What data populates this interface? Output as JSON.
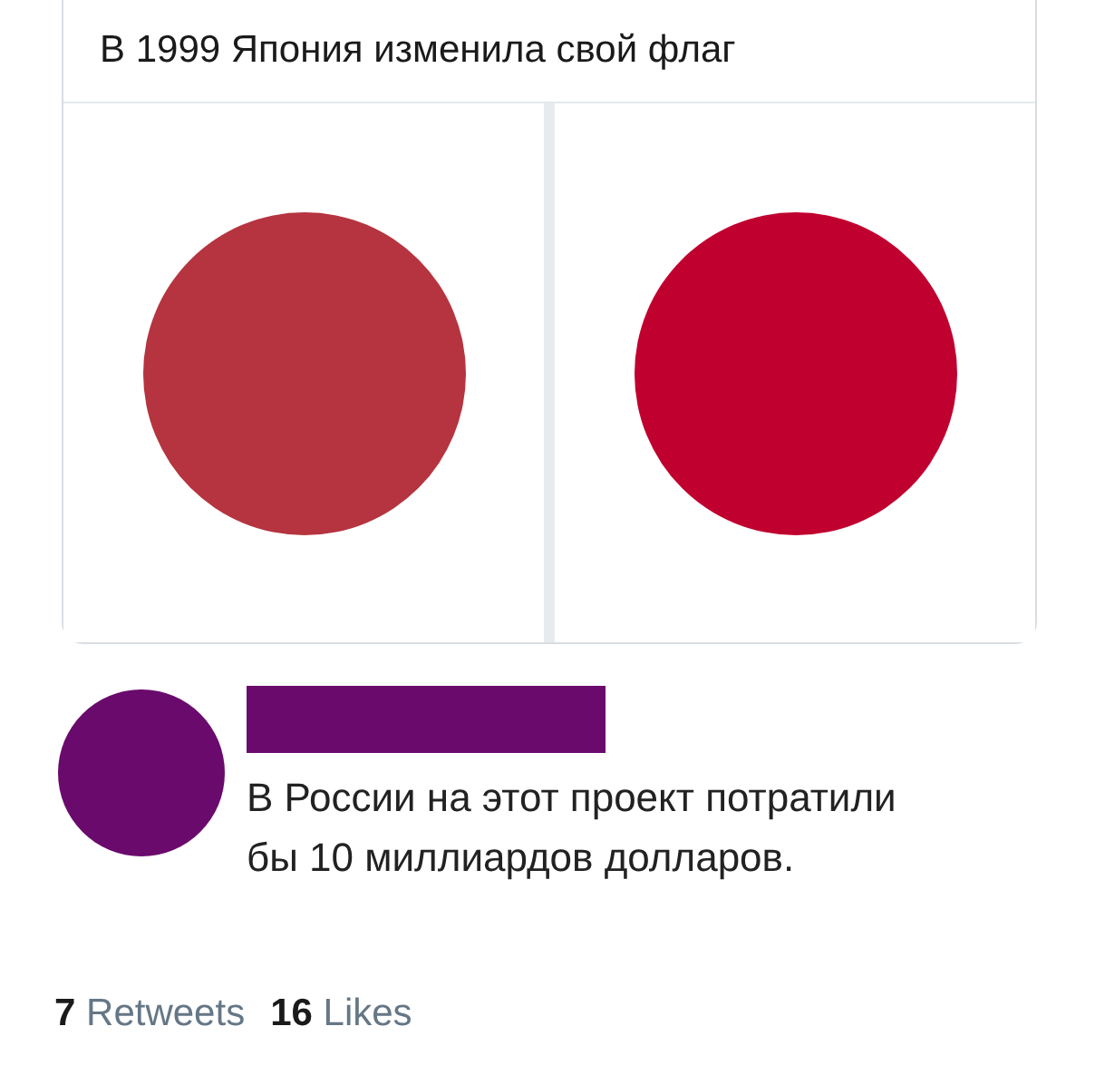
{
  "card": {
    "title": "В 1999 Япония изменила свой флаг",
    "flags": [
      {
        "color": "#b5343f"
      },
      {
        "color": "#c0002f"
      }
    ]
  },
  "reply": {
    "text": "В России на этот проект потратили бы 10 миллиардов долларов."
  },
  "stats": [
    {
      "count": "7",
      "label": "Retweets"
    },
    {
      "count": "16",
      "label": "Likes"
    }
  ]
}
